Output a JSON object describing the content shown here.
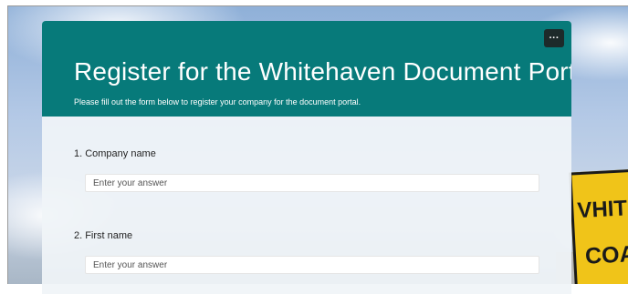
{
  "background_sign": {
    "line1": "VHITEH",
    "line2": "COAL"
  },
  "form": {
    "title": "Register for the Whitehaven Document Portal",
    "subtitle": "Please fill out the form below to register your company for the document portal.",
    "more_button_label": "···",
    "header_color": "#077a7a",
    "questions": [
      {
        "number": "1.",
        "label": "Company name",
        "placeholder": "Enter your answer"
      },
      {
        "number": "2.",
        "label": "First name",
        "placeholder": "Enter your answer"
      }
    ]
  }
}
